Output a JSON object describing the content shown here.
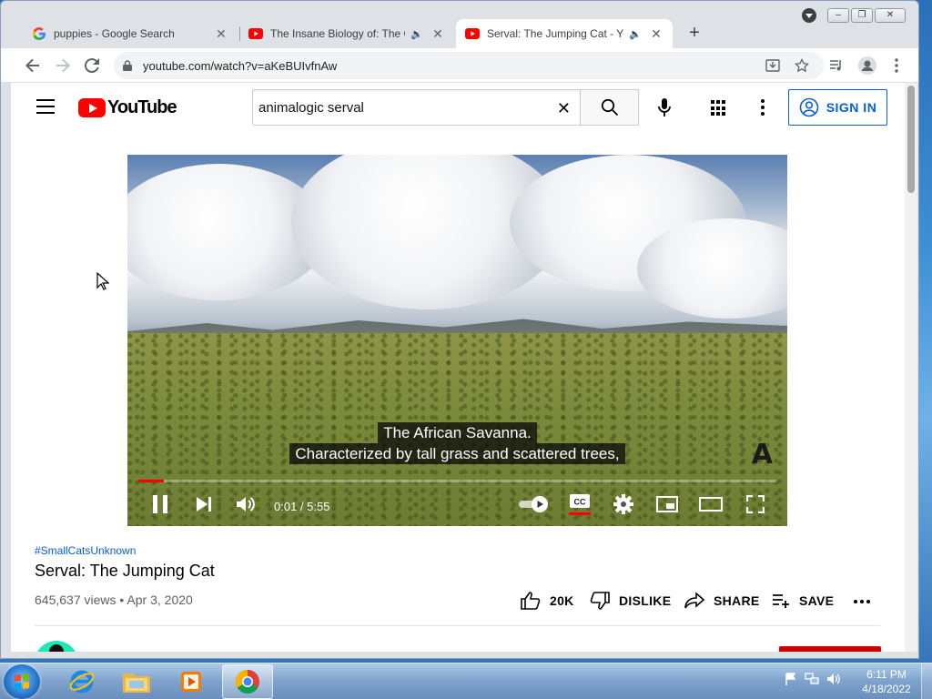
{
  "browser": {
    "tabs": [
      {
        "title": "puppies - Google Search",
        "favicon": "google-g-icon",
        "audio": false,
        "active": false
      },
      {
        "title": "The Insane Biology of: The Oc",
        "favicon": "youtube-icon",
        "audio": true,
        "active": false
      },
      {
        "title": "Serval: The Jumping Cat - Yo",
        "favicon": "youtube-icon",
        "audio": true,
        "active": true
      }
    ],
    "url": "youtube.com/watch?v=aKeBUIvfnAw"
  },
  "youtube": {
    "logo_text": "YouTube",
    "search_value": "animalogic serval",
    "signin_label": "SIGN IN"
  },
  "player": {
    "caption_line1": "The African Savanna.",
    "caption_line2": "Characterized by tall grass and scattered trees,",
    "watermark": "A",
    "time_display": "0:01 / 5:55",
    "progress_fraction": 0.005,
    "autoplay_on": true,
    "captions_on": true
  },
  "video": {
    "hashtag": "#SmallCatsUnknown",
    "title": "Serval: The Jumping Cat",
    "meta": "645,637 views • Apr 3, 2020",
    "like_count": "20K",
    "dislike_label": "DISLIKE",
    "share_label": "SHARE",
    "save_label": "SAVE"
  },
  "taskbar": {
    "time": "6:11 PM",
    "date": "4/18/2022"
  },
  "colors": {
    "youtube_red": "#ff0000",
    "link_blue": "#065fd4",
    "chrome_tabstrip": "#dee1e6"
  }
}
